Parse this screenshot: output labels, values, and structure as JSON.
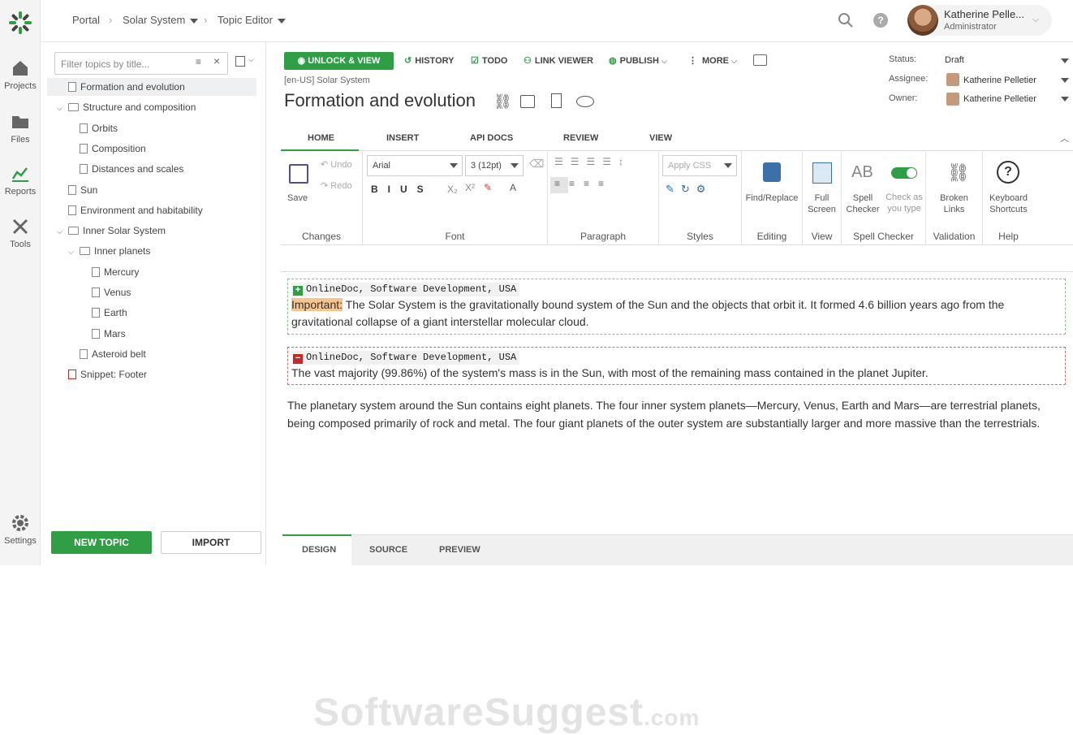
{
  "nav": {
    "items": [
      {
        "label": "Projects"
      },
      {
        "label": "Files"
      },
      {
        "label": "Reports"
      },
      {
        "label": "Tools"
      },
      {
        "label": "Settings"
      }
    ]
  },
  "breadcrumb": {
    "portal": "Portal",
    "project": "Solar System",
    "editor": "Topic Editor"
  },
  "user": {
    "name": "Katherine Pelle...",
    "role": "Administrator"
  },
  "sidebar": {
    "filter_placeholder": "Filter topics by title...",
    "tree": [
      {
        "label": "Formation and evolution",
        "level": 0,
        "type": "doc",
        "selected": true
      },
      {
        "label": "Structure and composition",
        "level": 0,
        "type": "folder",
        "open": true
      },
      {
        "label": "Orbits",
        "level": 1,
        "type": "doc"
      },
      {
        "label": "Composition",
        "level": 1,
        "type": "doc"
      },
      {
        "label": "Distances and scales",
        "level": 1,
        "type": "doc"
      },
      {
        "label": "Sun",
        "level": 0,
        "type": "doc"
      },
      {
        "label": "Environment and habitability",
        "level": 0,
        "type": "doc"
      },
      {
        "label": "Inner Solar System",
        "level": 0,
        "type": "folder",
        "open": true
      },
      {
        "label": "Inner planets",
        "level": 1,
        "type": "folder",
        "open": true
      },
      {
        "label": "Mercury",
        "level": 2,
        "type": "doc"
      },
      {
        "label": "Venus",
        "level": 2,
        "type": "doc"
      },
      {
        "label": "Earth",
        "level": 2,
        "type": "doc"
      },
      {
        "label": "Mars",
        "level": 2,
        "type": "doc"
      },
      {
        "label": "Asteroid belt",
        "level": 1,
        "type": "doc"
      },
      {
        "label": "Snippet: Footer",
        "level": 0,
        "type": "snippet"
      }
    ],
    "new_topic": "NEW TOPIC",
    "import": "IMPORT"
  },
  "toolbar": {
    "unlock": "UNLOCK & VIEW",
    "history": "HISTORY",
    "todo": "TODO",
    "link_viewer": "LINK VIEWER",
    "publish": "PUBLISH",
    "more": "MORE"
  },
  "meta": {
    "status_label": "Status:",
    "status": "Draft",
    "assignee_label": "Assignee:",
    "assignee": "Katherine Pelletier",
    "owner_label": "Owner:",
    "owner": "Katherine Pelletier"
  },
  "topic": {
    "path": "[en-US] Solar System",
    "title": "Formation and evolution"
  },
  "ribbon": {
    "tabs": [
      "HOME",
      "INSERT",
      "API DOCS",
      "REVIEW",
      "VIEW"
    ],
    "save": "Save",
    "undo": "Undo",
    "redo": "Redo",
    "font": "Arial",
    "size": "3 (12pt)",
    "apply_css": "Apply CSS",
    "find": "Find/Replace",
    "full1": "Full",
    "full2": "Screen",
    "spell1": "Spell",
    "spell2": "Checker",
    "check1": "Check as",
    "check2": "you type",
    "broken1": "Broken",
    "broken2": "Links",
    "kb1": "Keyboard",
    "kb2": "Shortcuts",
    "groups": [
      "Changes",
      "Font",
      "Paragraph",
      "Styles",
      "Editing",
      "View",
      "Spell Checker",
      "Validation",
      "Help"
    ]
  },
  "content": {
    "change1": {
      "tag": "OnlineDoc, Software Development, USA",
      "important": "Important:",
      "text": " The Solar System is the gravitationally bound system of the Sun and the objects that orbit it. It formed 4.6 billion years ago from the gravitational collapse of a giant interstellar molecular cloud."
    },
    "change2": {
      "tag": "OnlineDoc, Software Development, USA",
      "text": "The vast majority (99.86%) of the system's mass is in the Sun, with most of the remaining mass contained in the planet Jupiter."
    },
    "para": "The planetary system around the Sun contains eight planets. The four inner system planets—Mercury, Venus, Earth and Mars—are terrestrial planets, being composed primarily of rock and metal. The four giant planets of the outer system are substantially larger and more massive than the terrestrials."
  },
  "bottom_tabs": [
    "DESIGN",
    "SOURCE",
    "PREVIEW"
  ],
  "watermark": {
    "main": "SoftwareSuggest",
    "suffix": ".com"
  }
}
